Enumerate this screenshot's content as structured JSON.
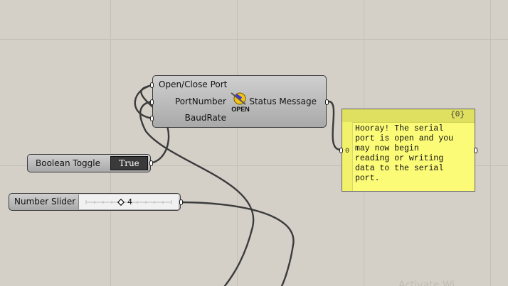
{
  "serial_component": {
    "inputs": [
      "Open/Close Port",
      "PortNumber",
      "BaudRate"
    ],
    "output": "Status Message",
    "icon_caption": "OPEN"
  },
  "boolean_toggle": {
    "label": "Boolean Toggle",
    "value": "True"
  },
  "number_slider": {
    "label": "Number Slider",
    "value": "4"
  },
  "panel": {
    "path": "{0}",
    "index": "0",
    "text": "Hooray! The serial\nport is open and you\nmay now begin\nreading or writing\ndata to the serial\nport."
  },
  "watermark": "Activate Wi",
  "colors": {
    "canvas": "#d4d0c8",
    "panel": "#fbfb78",
    "toggle_value_bg": "#3a3a3a"
  }
}
